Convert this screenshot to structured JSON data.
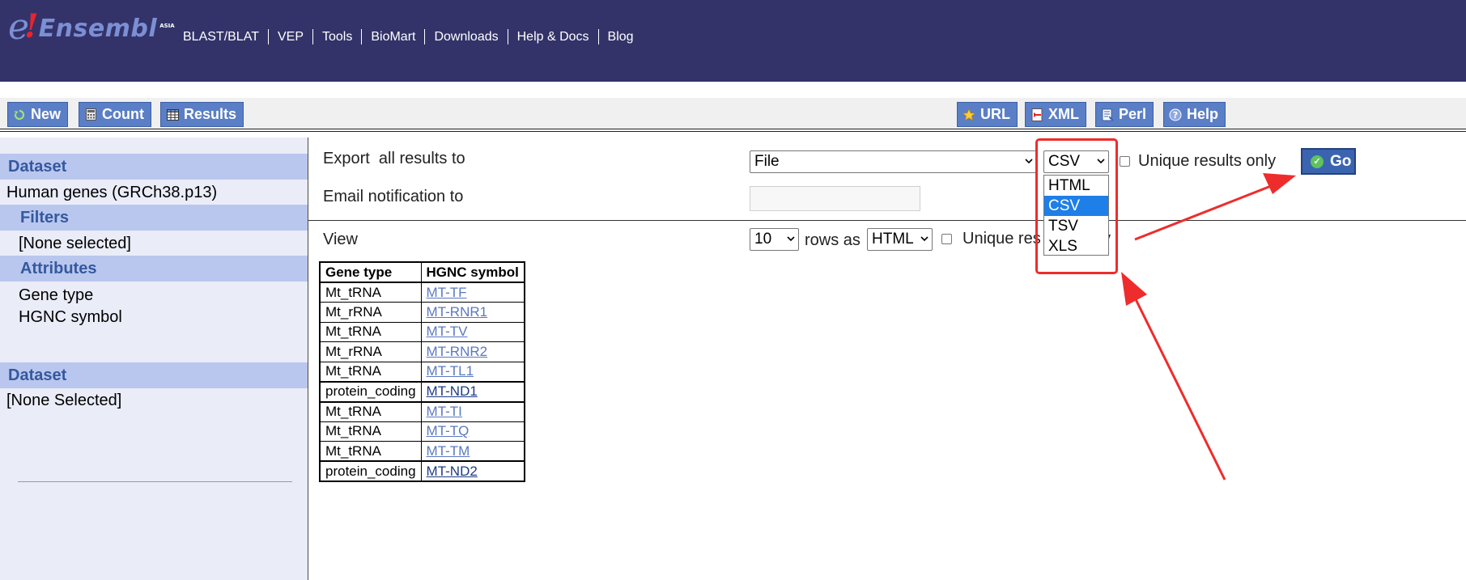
{
  "header": {
    "logo": {
      "e": "e",
      "bang": "!",
      "word": "Ensembl",
      "badge": "ASIA"
    },
    "nav": [
      "BLAST/BLAT",
      "VEP",
      "Tools",
      "BioMart",
      "Downloads",
      "Help & Docs",
      "Blog"
    ]
  },
  "toolbar": {
    "new_label": "New",
    "count_label": "Count",
    "results_label": "Results",
    "url_label": "URL",
    "xml_label": "XML",
    "perl_label": "Perl",
    "help_label": "Help"
  },
  "sidebar": {
    "dataset1_heading": "Dataset",
    "dataset1_value": "Human genes (GRCh38.p13)",
    "filters_heading": "Filters",
    "filters_value": "[None selected]",
    "attributes_heading": "Attributes",
    "attributes": [
      "Gene type",
      "HGNC symbol"
    ],
    "dataset2_heading": "Dataset",
    "dataset2_value": "[None Selected]"
  },
  "export": {
    "label": "Export  all results to",
    "destination": "File",
    "format_selected": "CSV",
    "format_options": [
      "HTML",
      "CSV",
      "TSV",
      "XLS"
    ],
    "unique_label": "Unique results only",
    "go_label": "Go",
    "email_label": "Email notification to",
    "email_value": ""
  },
  "view": {
    "label": "View",
    "rows_value": "10",
    "rows_as_label": "rows as",
    "format_value": "HTML",
    "unique_label_visible": "Unique res",
    "unique_label_tail": "y"
  },
  "table": {
    "headers": [
      "Gene type",
      "HGNC symbol"
    ],
    "rows": [
      [
        "Mt_tRNA",
        "MT-TF"
      ],
      [
        "Mt_rRNA",
        "MT-RNR1"
      ],
      [
        "Mt_tRNA",
        "MT-TV"
      ],
      [
        "Mt_rRNA",
        "MT-RNR2"
      ],
      [
        "Mt_tRNA",
        "MT-TL1"
      ],
      [
        "protein_coding",
        "MT-ND1"
      ],
      [
        "Mt_tRNA",
        "MT-TI"
      ],
      [
        "Mt_tRNA",
        "MT-TQ"
      ],
      [
        "Mt_tRNA",
        "MT-TM"
      ],
      [
        "protein_coding",
        "MT-ND2"
      ]
    ]
  },
  "colors": {
    "masthead": "#33336a",
    "toolbar_button": "#5b7fc6",
    "sidebar_bg": "#eaecf8",
    "sidebar_heading_bg": "#b9c7ee",
    "sidebar_heading_text": "#35589f",
    "annotation_red": "#ee2c2c",
    "selected_option": "#1e7fe8"
  },
  "icons": {
    "new": "refresh-icon",
    "count": "calculator-icon",
    "results": "table-icon",
    "url": "star-icon",
    "xml": "xml-icon",
    "perl": "script-icon",
    "help": "help-icon",
    "go": "check-circle-icon"
  }
}
